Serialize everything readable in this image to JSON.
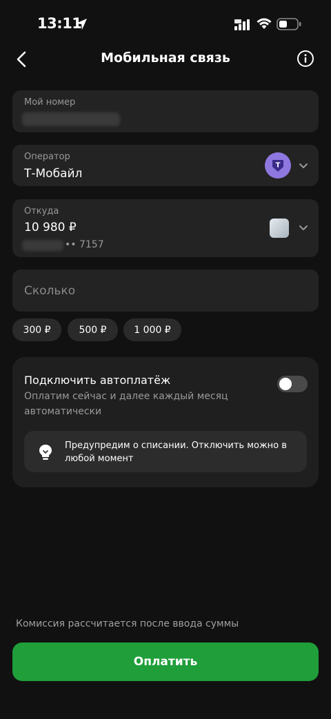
{
  "status": {
    "time": "13:11"
  },
  "header": {
    "title": "Мобильная связь"
  },
  "number": {
    "label": "Мой номер"
  },
  "operator": {
    "label": "Оператор",
    "value": "Т-Мобайл",
    "logo_letter": "T"
  },
  "source": {
    "label": "Откуда",
    "amount": "10 980 ₽",
    "card_suffix": "•• 7157"
  },
  "amount": {
    "placeholder": "Сколько"
  },
  "chips": [
    "300 ₽",
    "500 ₽",
    "1 000 ₽"
  ],
  "autopay": {
    "title": "Подключить автоплатёж",
    "subtitle_1": "Оплатим сейчас и далее каждый месяц",
    "subtitle_2": "автоматически",
    "info_1": "Предупредим о списании. Отключить можно в",
    "info_2": "любой момент",
    "enabled": false
  },
  "footer": {
    "commission": "Комиссия рассчитается после ввода суммы",
    "pay_label": "Оплатить"
  },
  "colors": {
    "accent": "#1f9e3a",
    "operator_logo": "#8f77e0",
    "background": "#111111"
  }
}
